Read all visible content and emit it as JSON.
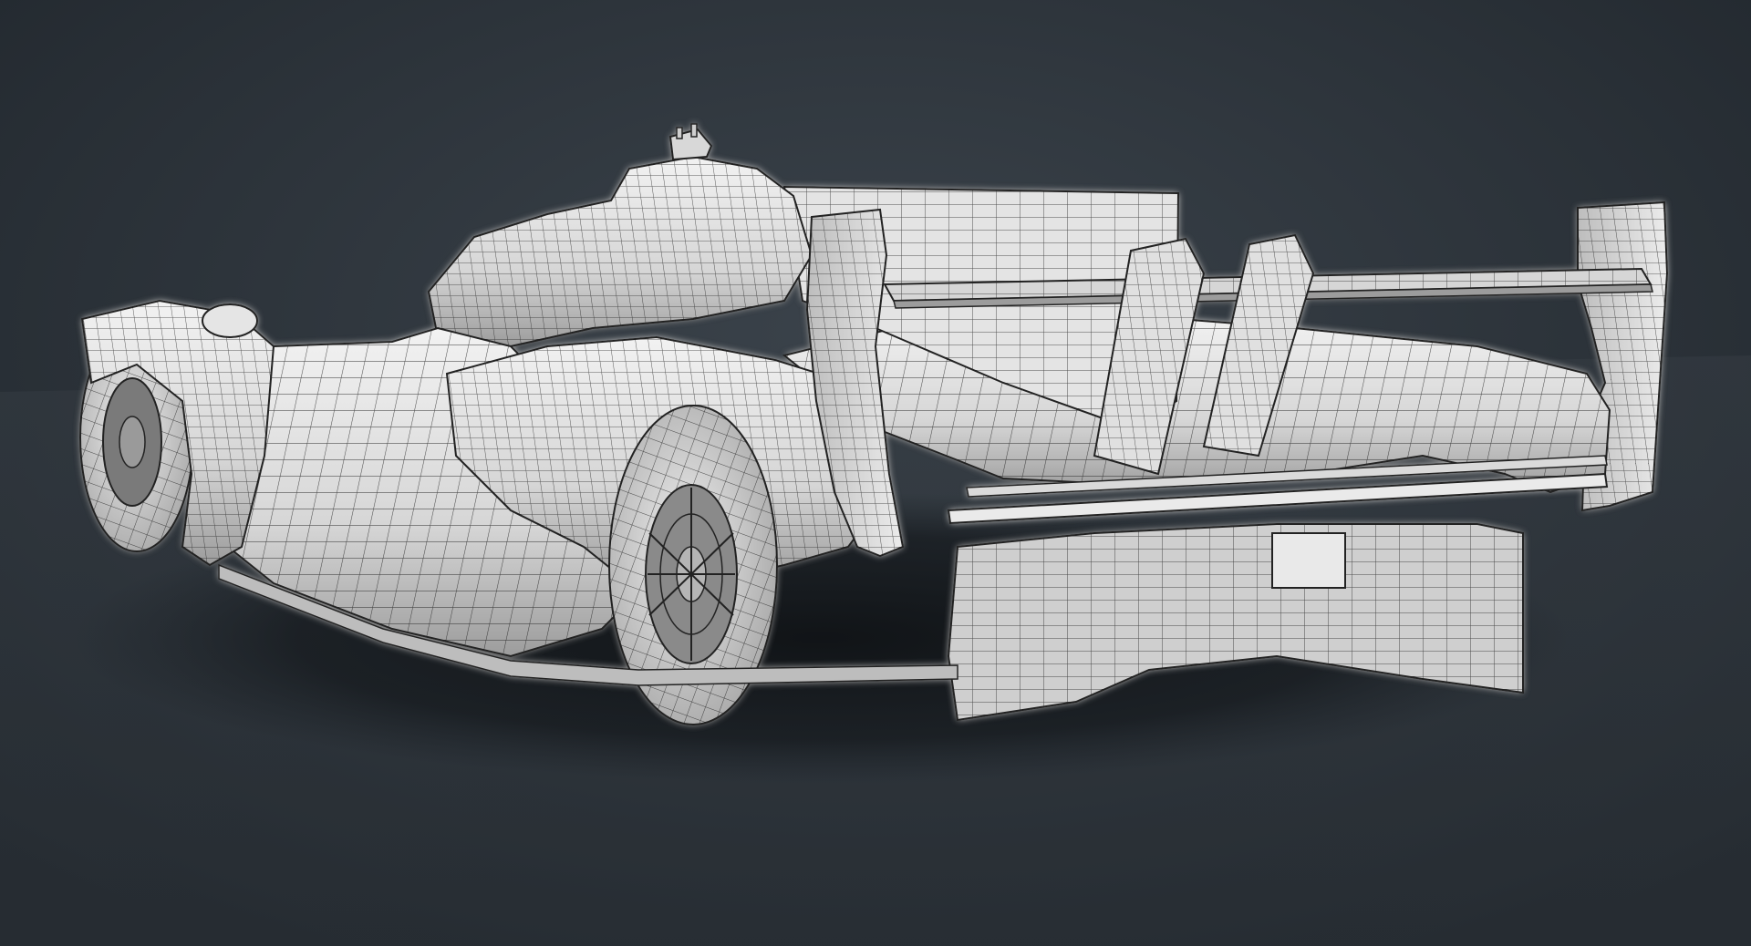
{
  "scene": {
    "subject": "wireframe-race-car",
    "colors": {
      "background_center": "#3b434b",
      "background_edge": "#1f252b",
      "floor": "#343b42",
      "body": "#dcdcdc",
      "body_shade": "#9a9a9a",
      "wire": "#222222",
      "tire": "#cfcfcf",
      "rim": "#6e6e6e",
      "shadow": "#15191d",
      "glow": "#fff6dc"
    }
  }
}
